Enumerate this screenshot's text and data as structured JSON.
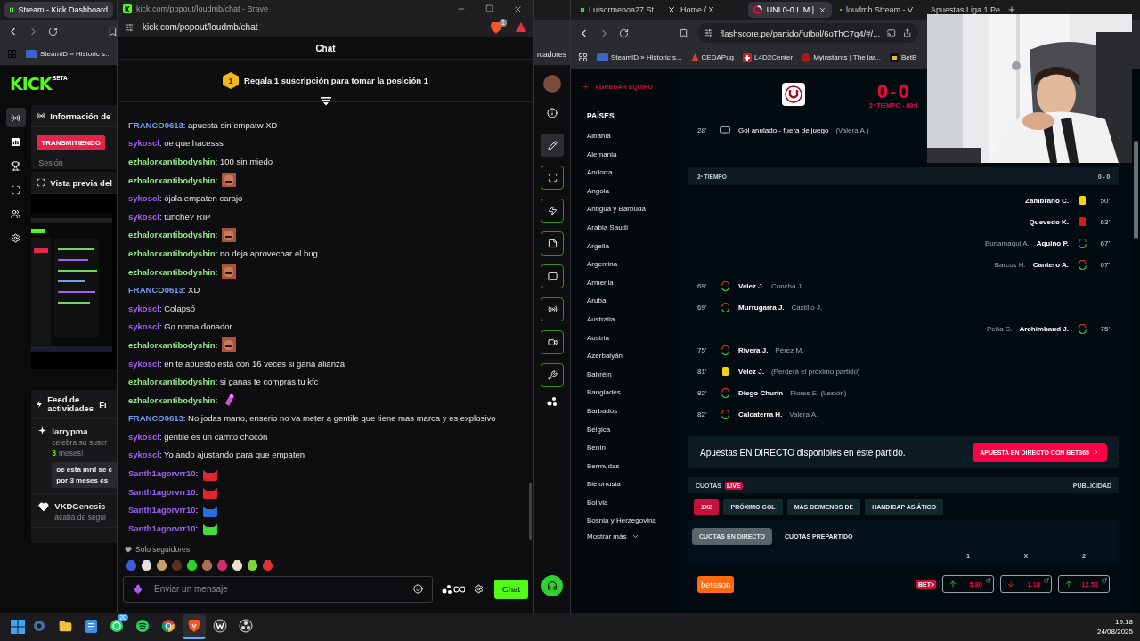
{
  "left_window": {
    "tab_title": "Stream - Kick Dashboard",
    "bookmark": "SteamID » Historic s...",
    "bookmark_tail": "rcadores",
    "logo": "KICK",
    "logo_badge": "BETA",
    "nav": [
      {
        "selected": true
      },
      {
        "selected": false
      },
      {
        "selected": false
      },
      {
        "selected": false
      },
      {
        "selected": false
      },
      {
        "selected": false
      }
    ],
    "info_panel": {
      "title": "Información de",
      "status": "TRANSMITIENDO",
      "session": "Sesión"
    },
    "preview_panel": {
      "title": "Vista previa del"
    },
    "feed": {
      "title": "Feed de actividades",
      "filter": "Fi",
      "events": [
        {
          "kind": "sub",
          "user": "larrypma",
          "text": "celebra su suscr",
          "months": "3",
          "months_rest": "meses!",
          "message": "oe esta mrd se c",
          "message_2": "por 3 meses cs"
        },
        {
          "kind": "follow",
          "user": "VKDGenesis",
          "text": "acaba de segui"
        }
      ]
    }
  },
  "chat_window": {
    "title": "kick.com/popout/loudmb/chat - Brave",
    "url": "kick.com/popout/loudmb/chat",
    "shield_count": "1",
    "header": "Chat",
    "pinned": {
      "rank": "1",
      "text": "Regala 1 suscripción para tomar la posición 1"
    },
    "messages": [
      {
        "user": "FRANCO0613",
        "color": "#6f9ff0",
        "text": ": apuesta sin empatw XD"
      },
      {
        "user": "sykoscl",
        "color": "#a45ef0",
        "text": ": oe que hacesss"
      },
      {
        "user": "ezhalorxantibodyshin",
        "color": "#93e88a",
        "text": ": 100 sin miedo"
      },
      {
        "user": "ezhalorxantibodyshin",
        "color": "#93e88a",
        "text": ":",
        "emote": true
      },
      {
        "user": "sykoscl",
        "color": "#a45ef0",
        "text": ": ójala empaten carajo"
      },
      {
        "user": "sykoscl",
        "color": "#a45ef0",
        "text": ": tunche? RIP"
      },
      {
        "user": "ezhalorxantibodyshin",
        "color": "#93e88a",
        "text": ":",
        "emote": true
      },
      {
        "user": "ezhalorxantibodyshin",
        "color": "#93e88a",
        "text": ": no deja aprovechar el bug"
      },
      {
        "user": "ezhalorxantibodyshin",
        "color": "#93e88a",
        "text": ":",
        "emote": true
      },
      {
        "user": "FRANCO0613",
        "color": "#6f9ff0",
        "text": ": XD"
      },
      {
        "user": "sykoscl",
        "color": "#a45ef0",
        "text": ": Colapsó"
      },
      {
        "user": "sykoscl",
        "color": "#a45ef0",
        "text": ": Go noma donador."
      },
      {
        "user": "ezhalorxantibodyshin",
        "color": "#93e88a",
        "text": ":",
        "emote": true
      },
      {
        "user": "sykoscl",
        "color": "#a45ef0",
        "text": ": en te apuesto está con 16 veces si gana alianza"
      },
      {
        "user": "ezhalorxantibodyshin",
        "color": "#93e88a",
        "text": ": si ganas te compras tu kfc"
      },
      {
        "user": "ezhalorxantibodyshin",
        "color": "#93e88a",
        "text": ":",
        "emote": true
      },
      {
        "user": "FRANCO0613",
        "color": "#6f9ff0",
        "text": ": No jodas mano, enserio no va meter a gentile que tiene mas marca y es explosivo"
      },
      {
        "user": "sykoscl",
        "color": "#a45ef0",
        "text": ": gentile es un carrito chocón"
      },
      {
        "user": "sykoscl",
        "color": "#a45ef0",
        "text": ": Yo ando ajustando para que empaten"
      },
      {
        "user": "Santh1agorvrr10",
        "color": "#9d5ff2",
        "text": ":",
        "emote": true
      },
      {
        "user": "Santh1agorvrr10",
        "color": "#9d5ff2",
        "text": ":",
        "emote": true
      },
      {
        "user": "Santh1agorvrr10",
        "color": "#9d5ff2",
        "text": ":",
        "emote": true
      },
      {
        "user": "Santh1agorvrr10",
        "color": "#9d5ff2",
        "text": ":",
        "emote": true
      }
    ],
    "followers_only": "Solo seguidores",
    "input": {
      "placeholder": "Enviar un mensaje"
    },
    "send": "Chat"
  },
  "right_window": {
    "tabs": [
      {
        "title": "Luisormenoa27 St",
        "selected": false
      },
      {
        "title": "Home / X",
        "selected": false
      },
      {
        "title": "UNI 0-0 LIM |",
        "selected": true
      },
      {
        "title": "loudmb Stream - V",
        "selected": false
      },
      {
        "title": "Apuestas Liga 1 Pe",
        "selected": false
      }
    ],
    "url": "flashscore.pe/partido/futbol/6oThC7q4/#/...",
    "bookmarks": [
      "SteamID » Historic s...",
      "CEDAPug",
      "L4D2Center",
      "Myinstants | The lar...",
      "BetB"
    ],
    "sidebar": {
      "add_team": "AGREGAR EQUIPO",
      "heading": "PAÍSES",
      "countries": [
        "Albania",
        "Alemania",
        "Andorra",
        "Angola",
        "Antigua y Barbuda",
        "Arabia Saudí",
        "Argelia",
        "Argentina",
        "Armenia",
        "Aruba",
        "Australia",
        "Austria",
        "Azerbaiyán",
        "Bahréin",
        "Bangladés",
        "Barbados",
        "Bélgica",
        "Benín",
        "Bermudas",
        "Bielorrusia",
        "Bolivia",
        "Bosnia y Herzegovina"
      ],
      "more": "Mostrar más"
    },
    "match": {
      "score": "0-0",
      "status": "2º TIEMPO - 89:1"
    },
    "first_half": [
      {
        "away": false,
        "minute": "28'",
        "kind": "var",
        "main": "Gol anulado - fuera de juego",
        "secondary": "(Valera A.)"
      }
    ],
    "second_half": {
      "label": "2º TIEMPO",
      "score": "0 - 0",
      "events": [
        {
          "away": true,
          "minute": "50'",
          "kind": "yellow",
          "main": "Zambrano C."
        },
        {
          "away": true,
          "minute": "63'",
          "kind": "red",
          "main": "Quevedo K."
        },
        {
          "away": true,
          "minute": "67'",
          "kind": "sub",
          "main": "Aquino P.",
          "secondary": "Burlamaqui A."
        },
        {
          "away": true,
          "minute": "67'",
          "kind": "sub",
          "main": "Cantero A.",
          "secondary": "Barcos H."
        },
        {
          "away": false,
          "minute": "69'",
          "kind": "sub",
          "main": "Velez J.",
          "secondary": "Concha J."
        },
        {
          "away": false,
          "minute": "69'",
          "kind": "sub",
          "main": "Murrugarra J.",
          "secondary": "Castillo J."
        },
        {
          "away": true,
          "minute": "75'",
          "kind": "sub",
          "main": "Archimbaud J.",
          "secondary": "Peña S."
        },
        {
          "away": false,
          "minute": "75'",
          "kind": "sub",
          "main": "Rivera J.",
          "secondary": "Pérez M."
        },
        {
          "away": false,
          "minute": "81'",
          "kind": "yellow",
          "main": "Velez J.",
          "secondary": "(Perderá el próximo partido)"
        },
        {
          "away": false,
          "minute": "82'",
          "kind": "sub",
          "main": "Diego Churin",
          "secondary": "Flores E. (Lesión)"
        },
        {
          "away": false,
          "minute": "82'",
          "kind": "sub",
          "main": "Calcaterra H.",
          "secondary": "Valera A."
        }
      ]
    },
    "live_bet": {
      "text": "Apuestas EN DIRECTO disponibles en este partido.",
      "button": "APUESTA EN DIRECTO CON BET365"
    },
    "odds": {
      "title": "CUOTAS",
      "live": "LIVE",
      "ad": "PUBLICIDAD",
      "markets": [
        {
          "label": "1X2",
          "selected": true
        },
        {
          "label": "PRÓXIMO GOL",
          "selected": false
        },
        {
          "label": "MÁS DE/MENOS DE",
          "selected": false
        },
        {
          "label": "HANDICAP ASIÁTICO",
          "selected": false
        }
      ],
      "modes": [
        {
          "label": "CUOTAS EN DIRECTO",
          "selected": true
        },
        {
          "label": "CUOTAS PREPARTIDO",
          "selected": false
        }
      ],
      "columns": [
        "1",
        "X",
        "2"
      ],
      "bookmakers": [
        {
          "name": "betsson",
          "badge": "BET>",
          "odds": [
            {
              "value": "5.80",
              "kind": "up"
            },
            {
              "value": "1.18",
              "kind": "down"
            },
            {
              "value": "12.50",
              "kind": "up"
            }
          ]
        }
      ]
    }
  },
  "taskbar": {
    "apps": [
      {
        "selected": false
      },
      {
        "selected": false
      },
      {
        "selected": false
      },
      {
        "selected": false,
        "badge": "20"
      },
      {
        "selected": false
      },
      {
        "selected": false
      },
      {
        "selected": true
      },
      {
        "selected": false
      },
      {
        "selected": false
      }
    ],
    "time": "19:18",
    "date": "24/08/2025"
  }
}
